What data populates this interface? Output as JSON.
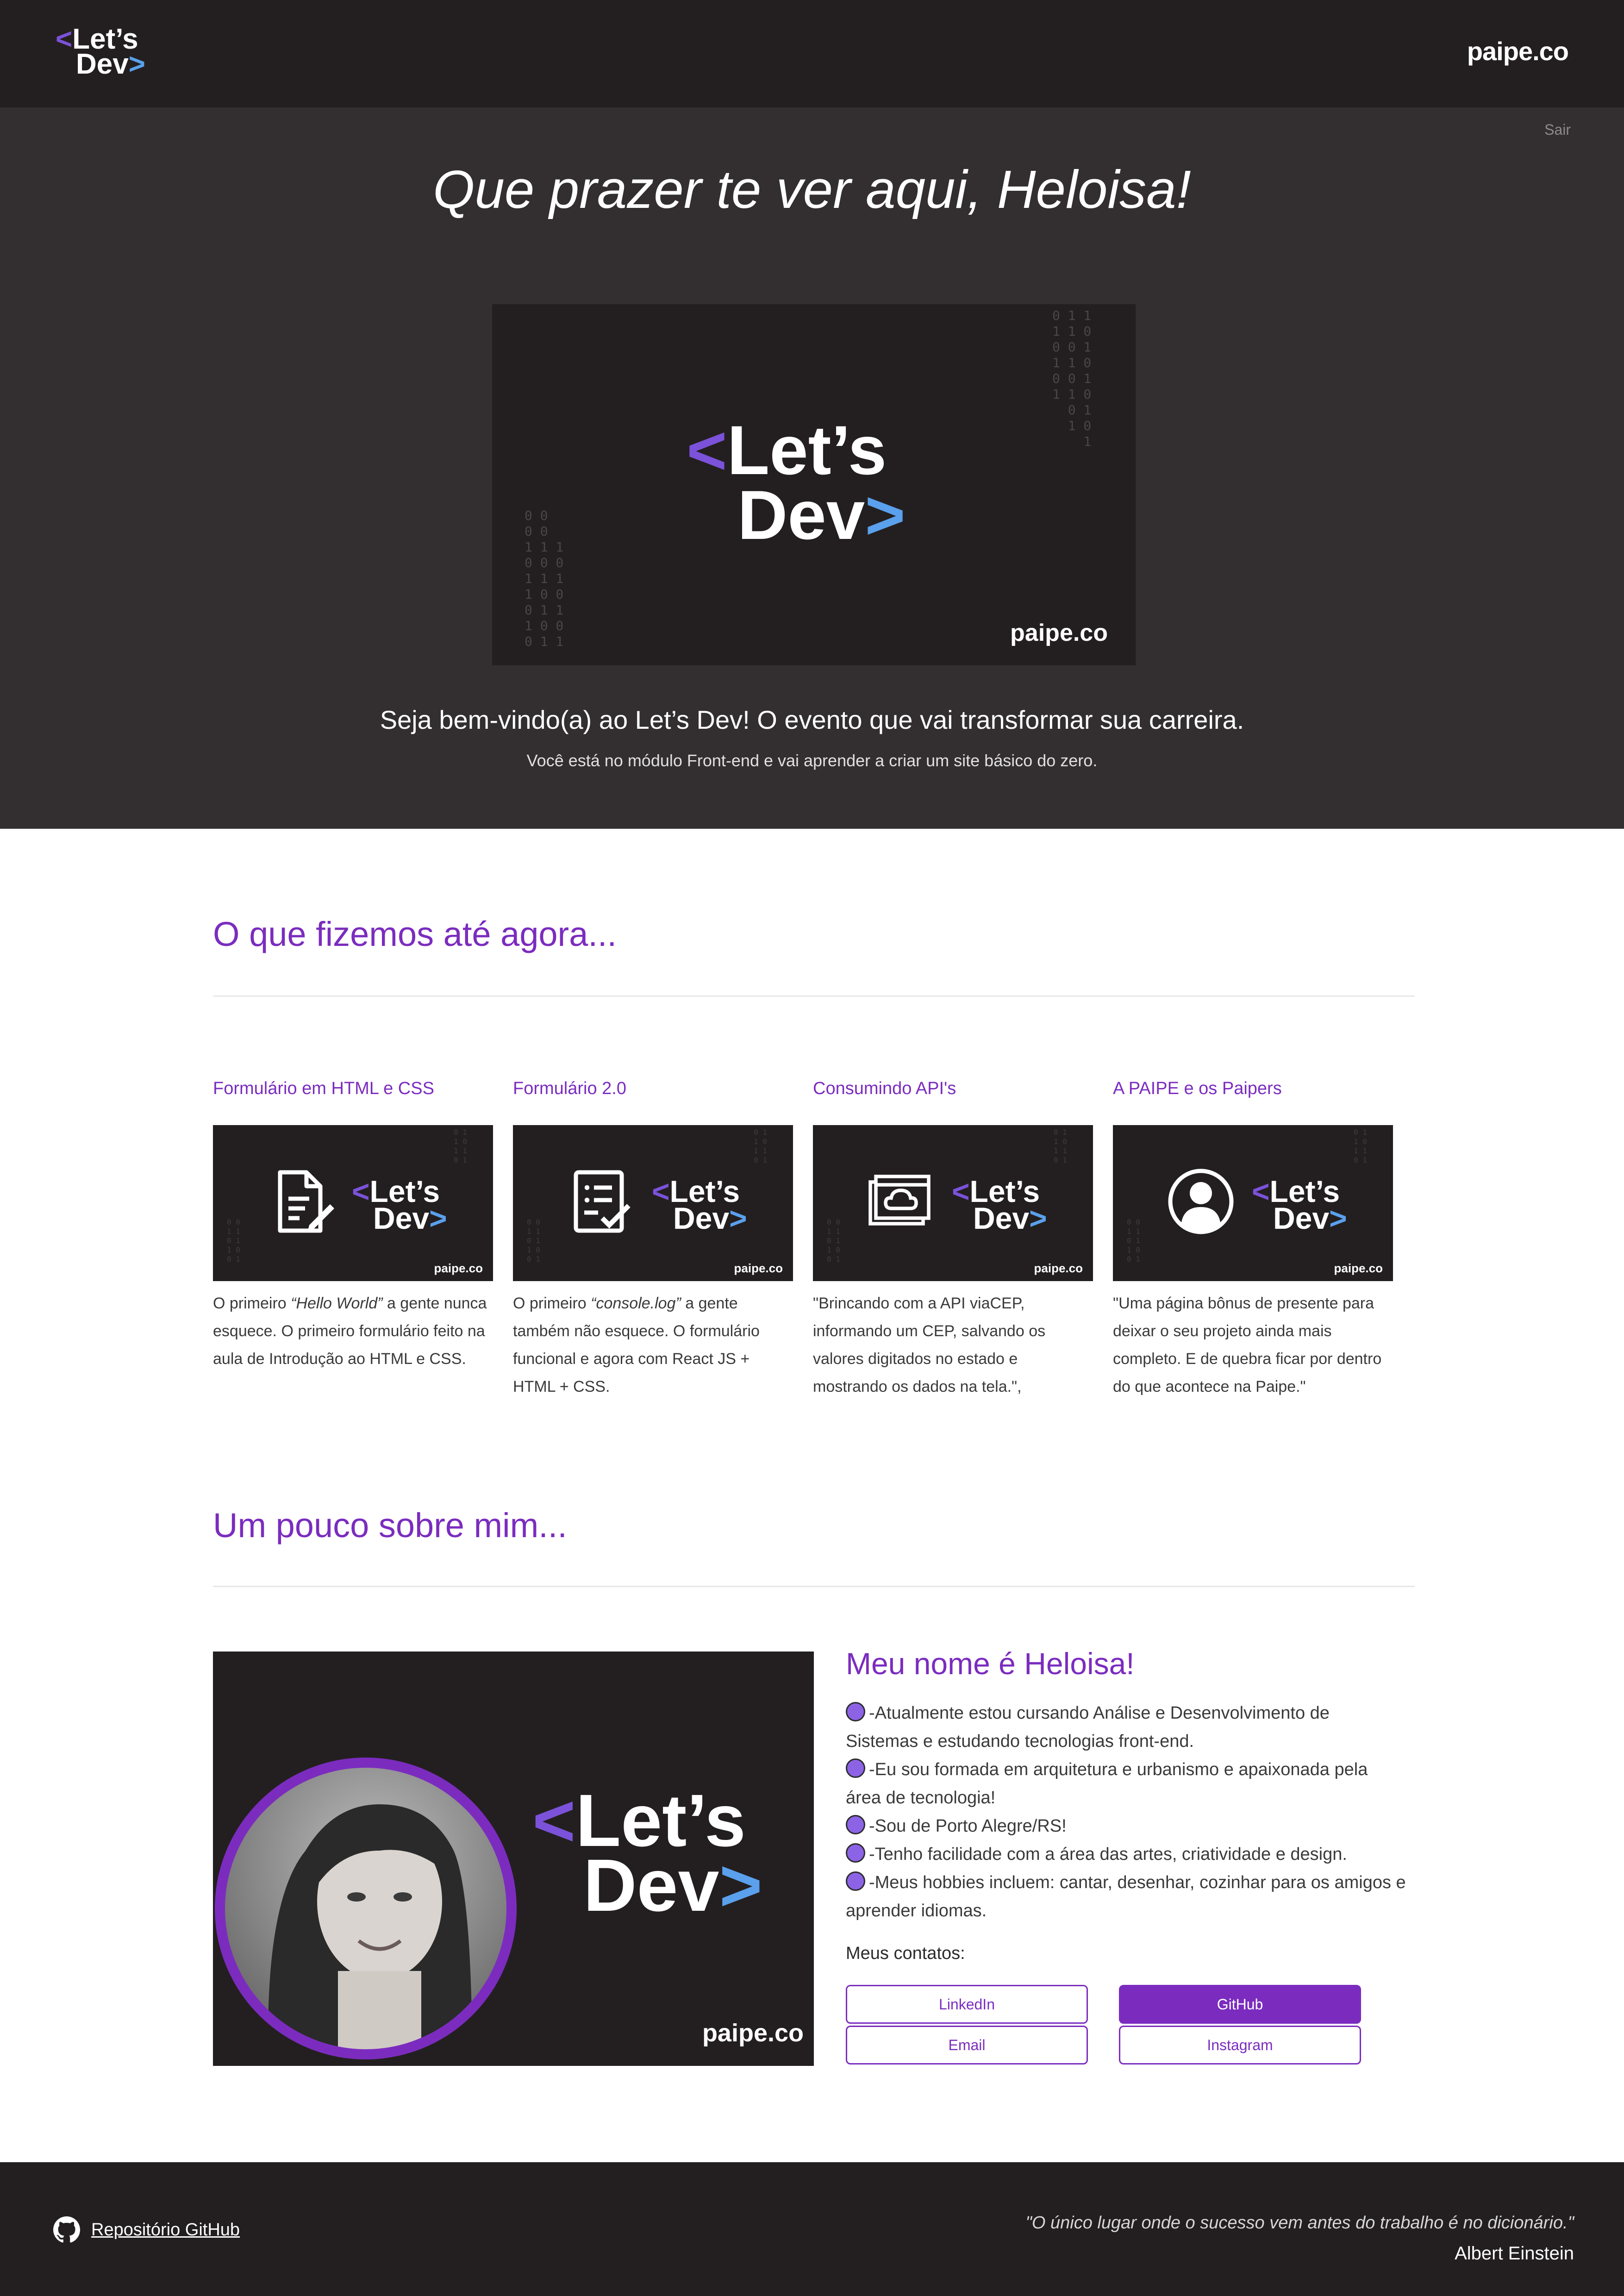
{
  "header": {
    "logo": {
      "line1": "Let’s",
      "line2": "Dev",
      "bracket_left": "<",
      "bracket_right": ">"
    },
    "brand": "paipe.co"
  },
  "hero": {
    "logout_label": "Sair",
    "title": "Que prazer te ver aqui, Heloisa!",
    "banner": {
      "line1": "Let’s",
      "line2": "Dev",
      "brand": "paipe.co"
    },
    "subtitle": "Seja bem-vindo(a) ao Let’s Dev! O evento que vai transformar sua carreira.",
    "note": "Você está no módulo Front-end e vai aprender a criar um site básico do zero."
  },
  "projects": {
    "title": "O que fizemos até agora...",
    "items": [
      {
        "title": "Formulário em HTML e CSS",
        "icon": "document-edit-icon",
        "desc_pre": "O primeiro ",
        "desc_em": "“Hello World”",
        "desc_post": " a gente nunca esquece. O primeiro formulário feito na aula de Introdução ao HTML e CSS."
      },
      {
        "title": "Formulário 2.0",
        "icon": "checklist-icon",
        "desc_pre": "O primeiro ",
        "desc_em": "“console.log”",
        "desc_post": " a gente também não esquece. O formulário funcional e agora com React JS + HTML + CSS."
      },
      {
        "title": "Consumindo API's",
        "icon": "cloud-window-icon",
        "desc_pre": "\"Brincando com a API viaCEP, informando um CEP, salvando os valores digitados no estado e mostrando os dados na tela.\",",
        "desc_em": "",
        "desc_post": ""
      },
      {
        "title": "A PAIPE e os Paipers",
        "icon": "user-circle-icon",
        "desc_pre": "\"Uma página bônus de presente para deixar o seu projeto ainda mais completo. E de quebra ficar por dentro do que acontece na Paipe.\"",
        "desc_em": "",
        "desc_post": ""
      }
    ],
    "card_logo": {
      "line1": "Let’s",
      "line2": "Dev",
      "brand": "paipe.co"
    }
  },
  "about": {
    "title": "Um pouco sobre mim...",
    "name": "Meu nome é Heloisa!",
    "image_logo": {
      "line1": "Let’s",
      "line2": "Dev",
      "brand": "paipe.co"
    },
    "facts": [
      "-Atualmente estou cursando Análise e Desenvolvimento de Sistemas e estudando tecnologias front-end.",
      "-Eu sou formada em arquitetura e urbanismo e apaixonada pela área de tecnologia!",
      "-Sou de Porto Alegre/RS!",
      "-Tenho facilidade com a área das artes, criatividade e design.",
      "-Meus hobbies incluem: cantar, desenhar, cozinhar para os amigos e aprender idiomas."
    ],
    "contacts_label": "Meus contatos:",
    "contacts": [
      "LinkedIn",
      "GitHub",
      "Email",
      "Instagram"
    ]
  },
  "footer": {
    "repo_link": "Repositório GitHub",
    "quote": "\"O único lugar onde o sucesso vem antes do trabalho é no dicionário.\"",
    "quote_author": "Albert Einstein"
  },
  "colors": {
    "accent": "#7b2cbf",
    "dark": "#231f20",
    "hero_bg": "#332f30",
    "bullet": "#8d63e6"
  }
}
